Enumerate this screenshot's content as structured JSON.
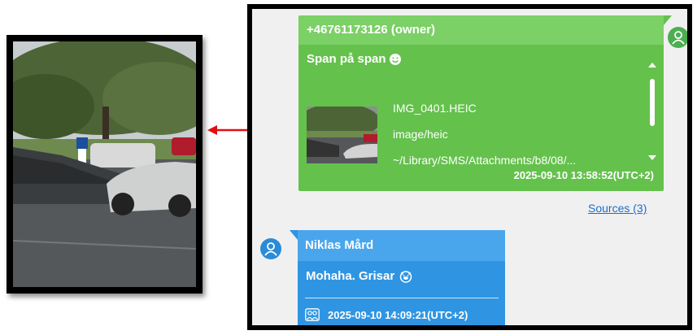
{
  "owner_message": {
    "sender": "+46761173126 (owner)",
    "text": "Span på span",
    "text_icon": "smiley-face-icon",
    "attachment": {
      "filename": "IMG_0401.HEIC",
      "mime": "image/heic",
      "path": "~/Library/SMS/Attachments/b8/08/..."
    },
    "timestamp": "2025-09-10 13:58:52(UTC+2)"
  },
  "sources_link": "Sources (3)",
  "niklas_message": {
    "sender": "Niklas Mård",
    "text": "Mohaha. Grisar",
    "text_icon": "pig-face-icon",
    "footer_icon": "group-participants-icon",
    "timestamp": "2025-09-10 14:09:21(UTC+2)"
  },
  "colors": {
    "owner_bubble": "#64c14c",
    "owner_header": "#7bd066",
    "niklas_bubble": "#2f95e2",
    "niklas_header": "#4aa6ec",
    "arrow": "#e01010",
    "link": "#1d6fc7"
  }
}
